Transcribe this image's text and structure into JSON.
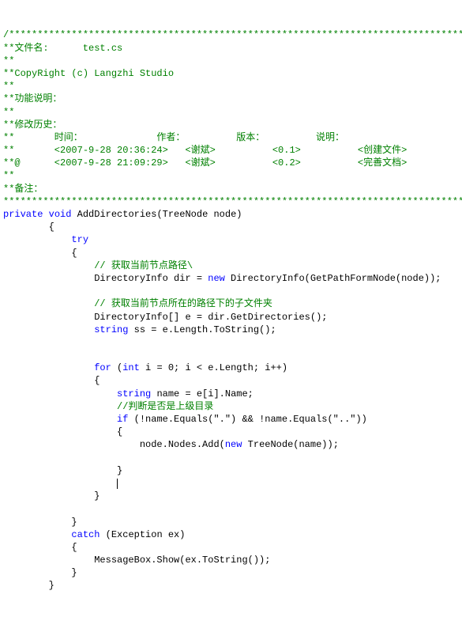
{
  "c": {
    "l1": "/*******************************************************************************************",
    "l2": "**文件名:      test.cs",
    "l3": "**",
    "l4": "**CopyRight (c) Langzhi Studio",
    "l5": "**",
    "l6": "**功能说明：",
    "l7": "**",
    "l8": "**修改历史：",
    "l9": "**       时间：             作者：         版本：         说明：",
    "l10": "**       <2007-9-28 20:36:24>   <谢斌>          <0.1>          <创建文件>",
    "l11": "**@      <2007-9-28 21:09:29>   <谢斌>          <0.2>          <完善文档>",
    "l12": "**",
    "l13": "**备注：",
    "l14": "********************************************************************************************/"
  },
  "k": {
    "private": "private",
    "void": "void",
    "try": "try",
    "new": "new",
    "string": "string",
    "for": "for",
    "int": "int",
    "if": "if",
    "catch": "catch"
  },
  "t": {
    "sig": " AddDirectories(TreeNode node)",
    "ob": "        {",
    "tryob": "            {",
    "c1": "                // 获取当前节点路径\\",
    "d1a": "                DirectoryInfo dir = ",
    "d1b": " DirectoryInfo(GetPathFormNode(node));",
    "c2": "                // 获取当前节点所在的路径下的子文件夹",
    "d2": "                DirectoryInfo[] e = dir.GetDirectories();",
    "d3a": "                ",
    "d3b": " ss = e.Length.ToString();",
    "fora": "                ",
    "forb": " (",
    "forc": " i = 0; i < e.Length; i++)",
    "forob": "                {",
    "n1a": "                    ",
    "n1b": " name = e[i].Name;",
    "c3": "                    //判断是否是上级目录",
    "ifa": "                    ",
    "ifb": " (!name.Equals(\".\") && !name.Equals(\"..\"))",
    "ifob": "                    {",
    "add1": "                        node.Nodes.Add(",
    "add2": " TreeNode(name));",
    "ifcb": "                    }",
    "forcb": "                }",
    "trycb": "            }",
    "catcha": "            ",
    "catchb": " (Exception ex)",
    "catchob": "            {",
    "mb": "                MessageBox.Show(ex.ToString());",
    "catchcb": "            }",
    "cb": "        }"
  }
}
